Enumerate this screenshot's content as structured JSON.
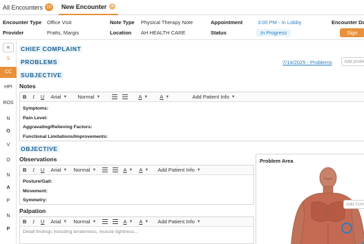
{
  "tabs": [
    {
      "label": "All Encounters",
      "badge": "10"
    },
    {
      "label": "New Encounter",
      "close": "×"
    }
  ],
  "header": {
    "encounter_type_label": "Encounter Type",
    "encounter_type_value": "Office Visit",
    "note_type_label": "Note Type",
    "note_type_value": "Physical Therapy Note",
    "appointment_label": "Appointment",
    "appointment_value": "3:00 PM - In Lobby",
    "encounter_date_label": "Encounter Date",
    "provider_label": "Provider",
    "provider_value": "Pratts, Margis",
    "location_label": "Location",
    "location_value": "AH HEALTH CARE",
    "status_label": "Status",
    "status_value": "In Progress",
    "sign_label": "Sign"
  },
  "leftnav": {
    "collapse": "«",
    "items": [
      "S",
      "CC",
      "HPI",
      "ROS",
      "N",
      "O",
      "V",
      "O",
      "N",
      "A",
      "P",
      "N",
      "P"
    ]
  },
  "content": {
    "chief_complaint": "CHIEF COMPLAINT",
    "problems": "PROBLEMS",
    "problems_link": "7/14/2025 - Problems",
    "add_problem_placeholder": "Add problem",
    "subjective": "SUBJECTIVE",
    "notes_label": "Notes",
    "notes_fields": [
      "Symptoms:",
      "Pain Level:",
      "Aggravating/Relieving Factors:",
      "Functional Limitations/Improvements:"
    ],
    "objective": "OBJECTIVE",
    "observations_label": "Observations",
    "observations_fields": [
      "Posture/Gait:",
      "Movement:",
      "Symmetry:"
    ],
    "palpation_label": "Palpation",
    "palpation_placeholder": "Detail findings including tenderness, muscle tightness...",
    "problem_area_label": "Problem Area",
    "add_comment_placeholder": "Add Comment"
  },
  "toolbar": {
    "bold": "B",
    "italic": "I",
    "underline": "U",
    "font": "Arial",
    "size": "Normal",
    "add_patient_info": "Add Patient Info"
  },
  "colors": {
    "accent": "#e8913a",
    "link": "#2a7fc1",
    "section_title": "#1b5d8c",
    "section_bg": "#e8f4fb",
    "backdrop": "#5e7f7a"
  }
}
